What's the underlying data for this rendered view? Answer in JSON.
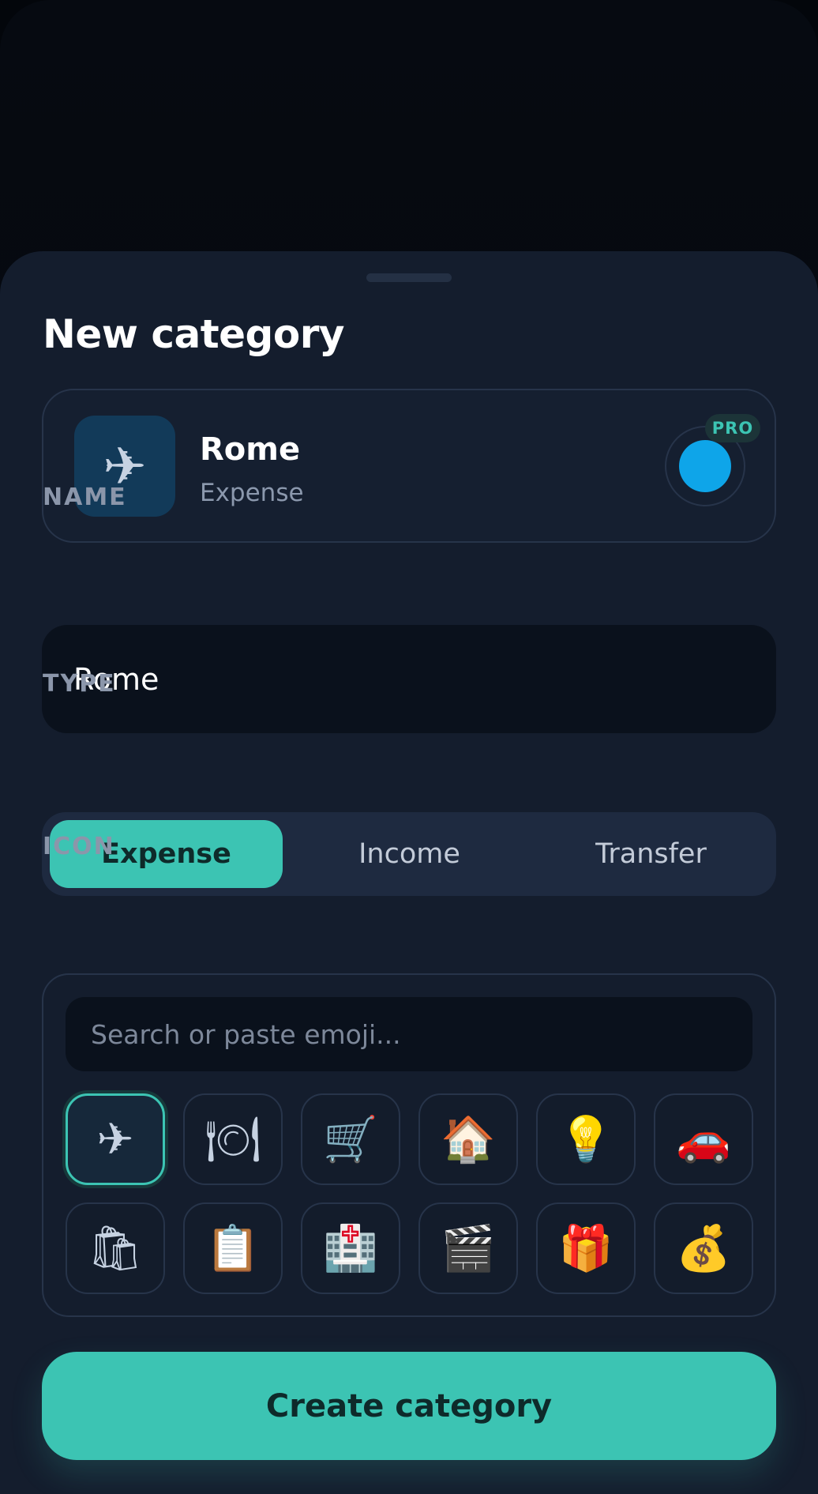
{
  "sheet": {
    "title": "New category"
  },
  "preview": {
    "icon": "✈",
    "icon_name": "airplane-icon",
    "name": "Rome",
    "type": "Expense",
    "color": "#0ea5e9",
    "badge": "PRO"
  },
  "name_field": {
    "label": "NAME",
    "value": "Rome"
  },
  "type_selector": {
    "label": "TYPE",
    "options": [
      "Expense",
      "Income",
      "Transfer"
    ],
    "selected": "Expense"
  },
  "icon_picker": {
    "label": "ICON",
    "search_placeholder": "Search or paste emoji...",
    "icons": [
      {
        "glyph": "✈",
        "name": "airplane-icon",
        "selected": true
      },
      {
        "glyph": "🍽",
        "name": "plate-cutlery-icon"
      },
      {
        "glyph": "🛒",
        "name": "shopping-cart-icon"
      },
      {
        "glyph": "🏠",
        "name": "house-icon"
      },
      {
        "glyph": "💡",
        "name": "light-bulb-icon"
      },
      {
        "glyph": "🚗",
        "name": "car-icon"
      },
      {
        "glyph": "🛍",
        "name": "shopping-bags-icon"
      },
      {
        "glyph": "📋",
        "name": "clipboard-icon"
      },
      {
        "glyph": "🏥",
        "name": "medical-icon"
      },
      {
        "glyph": "🎬",
        "name": "clapperboard-icon"
      },
      {
        "glyph": "🎁",
        "name": "gift-icon"
      },
      {
        "glyph": "💰",
        "name": "money-bag-icon"
      }
    ]
  },
  "colors": {
    "accent": "#3cc4b3",
    "sheet_bg": "#141d2d",
    "selected_color": "#0ea5e9"
  },
  "actions": {
    "create_label": "Create category"
  }
}
